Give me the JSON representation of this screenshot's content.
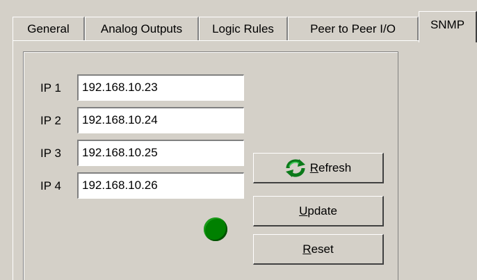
{
  "tabs": [
    {
      "label": "General",
      "active": false
    },
    {
      "label": "Analog Outputs",
      "active": false
    },
    {
      "label": "Logic Rules",
      "active": false
    },
    {
      "label": "Peer to Peer I/O",
      "active": false
    },
    {
      "label": "SNMP",
      "active": true
    }
  ],
  "ip_fields": [
    {
      "label": "IP 1",
      "value": "192.168.10.23"
    },
    {
      "label": "IP 2",
      "value": "192.168.10.24"
    },
    {
      "label": "IP 3",
      "value": "192.168.10.25"
    },
    {
      "label": "IP 4",
      "value": "192.168.10.26"
    }
  ],
  "buttons": {
    "refresh": {
      "mnemonic": "R",
      "rest": "efresh",
      "icon": "refresh-icon"
    },
    "update": {
      "mnemonic": "U",
      "rest": "pdate"
    },
    "reset": {
      "mnemonic": "R",
      "rest": "eset"
    }
  },
  "status_indicator": {
    "color": "#008000",
    "state": "ok"
  }
}
